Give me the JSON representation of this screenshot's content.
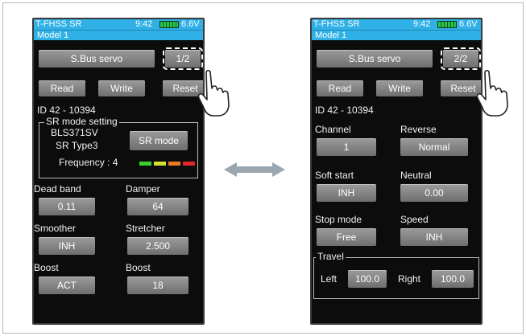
{
  "screens": [
    {
      "status": {
        "system": "T-FHSS SR",
        "clock": "9:42",
        "voltage": "6.6V"
      },
      "model": "Model 1",
      "title_button": "S.Bus servo",
      "page_button": "1/2",
      "actions": {
        "read": "Read",
        "write": "Write",
        "reset": "Reset"
      },
      "id_text": "ID  42  -  10394",
      "sr_mode": {
        "legend": "SR mode setting",
        "servo_model": "BLS371SV",
        "servo_type": "SR Type3",
        "button": "SR mode",
        "frequency_label": "Frequency : 4",
        "frequency_colors": [
          "#39d02a",
          "#d4e22a",
          "#ef7a22",
          "#e2262a"
        ]
      },
      "params": [
        {
          "label": "Dead band",
          "value": "0.11"
        },
        {
          "label": "Damper",
          "value": "64"
        },
        {
          "label": "Smoother",
          "value": "INH"
        },
        {
          "label": "Stretcher",
          "value": "2.500"
        },
        {
          "label": "Boost",
          "value": "ACT"
        },
        {
          "label": "Boost",
          "value": "18"
        }
      ]
    },
    {
      "status": {
        "system": "T-FHSS SR",
        "clock": "9:42",
        "voltage": "6.6V"
      },
      "model": "Model 1",
      "title_button": "S.Bus servo",
      "page_button": "2/2",
      "actions": {
        "read": "Read",
        "write": "Write",
        "reset": "Reset"
      },
      "id_text": "ID  42  -  10394",
      "params": [
        {
          "label": "Channel",
          "value": "1"
        },
        {
          "label": "Reverse",
          "value": "Normal"
        },
        {
          "label": "Soft start",
          "value": "INH"
        },
        {
          "label": "Neutral",
          "value": "0.00"
        },
        {
          "label": "Stop mode",
          "value": "Free"
        },
        {
          "label": "Speed",
          "value": "INH"
        }
      ],
      "travel": {
        "legend": "Travel",
        "left_label": "Left",
        "left_value": "100.0",
        "right_label": "Right",
        "right_value": "100.0"
      }
    }
  ],
  "icons": {
    "arrow": "double-arrow-icon",
    "hand": "pointing-hand-icon"
  }
}
